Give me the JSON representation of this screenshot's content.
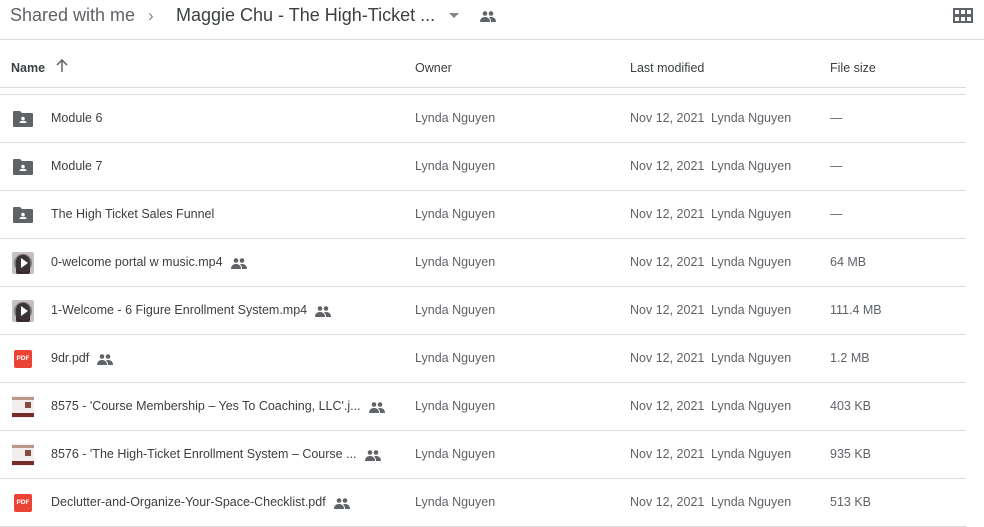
{
  "breadcrumb": {
    "root": "Shared with me",
    "separator": "›",
    "current": "Maggie Chu - The High-Ticket ..."
  },
  "icons": {
    "dropdown": "caret-down-icon",
    "shared_folder": "people-icon",
    "view_toggle": "grid-view-icon"
  },
  "columns": {
    "name": "Name",
    "owner": "Owner",
    "last_modified": "Last modified",
    "file_size": "File size",
    "sort": "ascending"
  },
  "colors": {
    "text": "#3c4043",
    "muted": "#5f6368",
    "divider": "#dadce0",
    "pdf": "#ea4335"
  },
  "files": [
    {
      "name": "Module 6",
      "type": "shared-folder",
      "shared": false,
      "owner": "Lynda Nguyen",
      "modified": "Nov 12, 2021",
      "modified_by": "Lynda Nguyen",
      "size": "—"
    },
    {
      "name": "Module 7",
      "type": "shared-folder",
      "shared": false,
      "owner": "Lynda Nguyen",
      "modified": "Nov 12, 2021",
      "modified_by": "Lynda Nguyen",
      "size": "—"
    },
    {
      "name": "The High Ticket Sales Funnel",
      "type": "shared-folder",
      "shared": false,
      "owner": "Lynda Nguyen",
      "modified": "Nov 12, 2021",
      "modified_by": "Lynda Nguyen",
      "size": "—"
    },
    {
      "name": "0-welcome portal w music.mp4",
      "type": "video",
      "shared": true,
      "owner": "Lynda Nguyen",
      "modified": "Nov 12, 2021",
      "modified_by": "Lynda Nguyen",
      "size": "64 MB"
    },
    {
      "name": "1-Welcome - 6 Figure Enrollment System.mp4",
      "type": "video",
      "shared": true,
      "owner": "Lynda Nguyen",
      "modified": "Nov 12, 2021",
      "modified_by": "Lynda Nguyen",
      "size": "111.4 MB"
    },
    {
      "name": "9dr.pdf",
      "type": "pdf",
      "shared": true,
      "owner": "Lynda Nguyen",
      "modified": "Nov 12, 2021",
      "modified_by": "Lynda Nguyen",
      "size": "1.2 MB"
    },
    {
      "name": "8575 - 'Course Membership – Yes To Coaching, LLC'.j...",
      "type": "image",
      "shared": true,
      "owner": "Lynda Nguyen",
      "modified": "Nov 12, 2021",
      "modified_by": "Lynda Nguyen",
      "size": "403 KB"
    },
    {
      "name": "8576 - 'The High-Ticket Enrollment System – Course ...",
      "type": "image",
      "shared": true,
      "owner": "Lynda Nguyen",
      "modified": "Nov 12, 2021",
      "modified_by": "Lynda Nguyen",
      "size": "935 KB"
    },
    {
      "name": "Declutter-and-Organize-Your-Space-Checklist.pdf",
      "type": "pdf",
      "shared": true,
      "owner": "Lynda Nguyen",
      "modified": "Nov 12, 2021",
      "modified_by": "Lynda Nguyen",
      "size": "513 KB"
    }
  ],
  "pdf_label": "PDF"
}
